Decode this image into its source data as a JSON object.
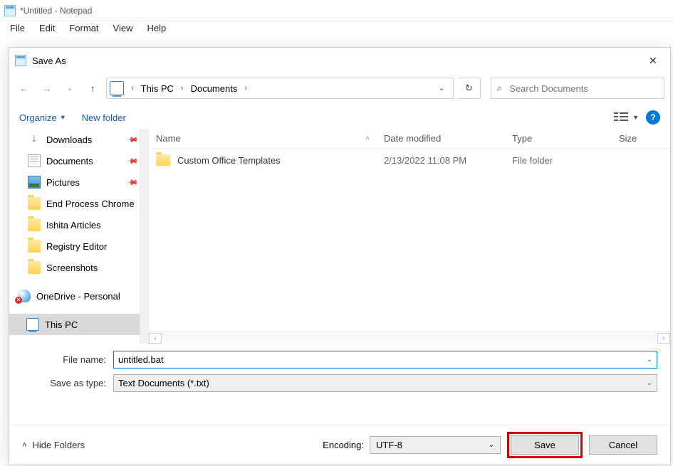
{
  "window": {
    "title": "*Untitled - Notepad"
  },
  "menu": {
    "items": [
      "File",
      "Edit",
      "Format",
      "View",
      "Help"
    ]
  },
  "dialog": {
    "title": "Save As",
    "breadcrumb": {
      "parts": [
        "This PC",
        "Documents"
      ]
    },
    "search_placeholder": "Search Documents",
    "toolbar": {
      "organize": "Organize",
      "new_folder": "New folder"
    },
    "columns": {
      "name": "Name",
      "date": "Date modified",
      "type": "Type",
      "size": "Size"
    },
    "tree": [
      {
        "id": "downloads",
        "label": "Downloads",
        "icon": "downloads",
        "pinned": true
      },
      {
        "id": "documents",
        "label": "Documents",
        "icon": "documents",
        "pinned": true
      },
      {
        "id": "pictures",
        "label": "Pictures",
        "icon": "pictures",
        "pinned": true
      },
      {
        "id": "endproc",
        "label": "End Process Chrome",
        "icon": "folder"
      },
      {
        "id": "ishita",
        "label": "Ishita Articles",
        "icon": "folder"
      },
      {
        "id": "registry",
        "label": "Registry Editor",
        "icon": "folder"
      },
      {
        "id": "screenshots",
        "label": "Screenshots",
        "icon": "folder"
      },
      {
        "id": "onedrive",
        "label": "OneDrive - Personal",
        "icon": "onedrive",
        "error": true,
        "group": true
      },
      {
        "id": "thispc",
        "label": "This PC",
        "icon": "pc",
        "selected": true,
        "group": true
      }
    ],
    "items": [
      {
        "name": "Custom Office Templates",
        "date": "2/13/2022 11:08 PM",
        "type": "File folder",
        "size": ""
      }
    ],
    "filename_label": "File name:",
    "filename": "untitled.bat",
    "saveastype_label": "Save as type:",
    "saveastype": "Text Documents (*.txt)",
    "encoding_label": "Encoding:",
    "encoding": "UTF-8",
    "hide_folders": "Hide Folders",
    "save": "Save",
    "cancel": "Cancel"
  }
}
